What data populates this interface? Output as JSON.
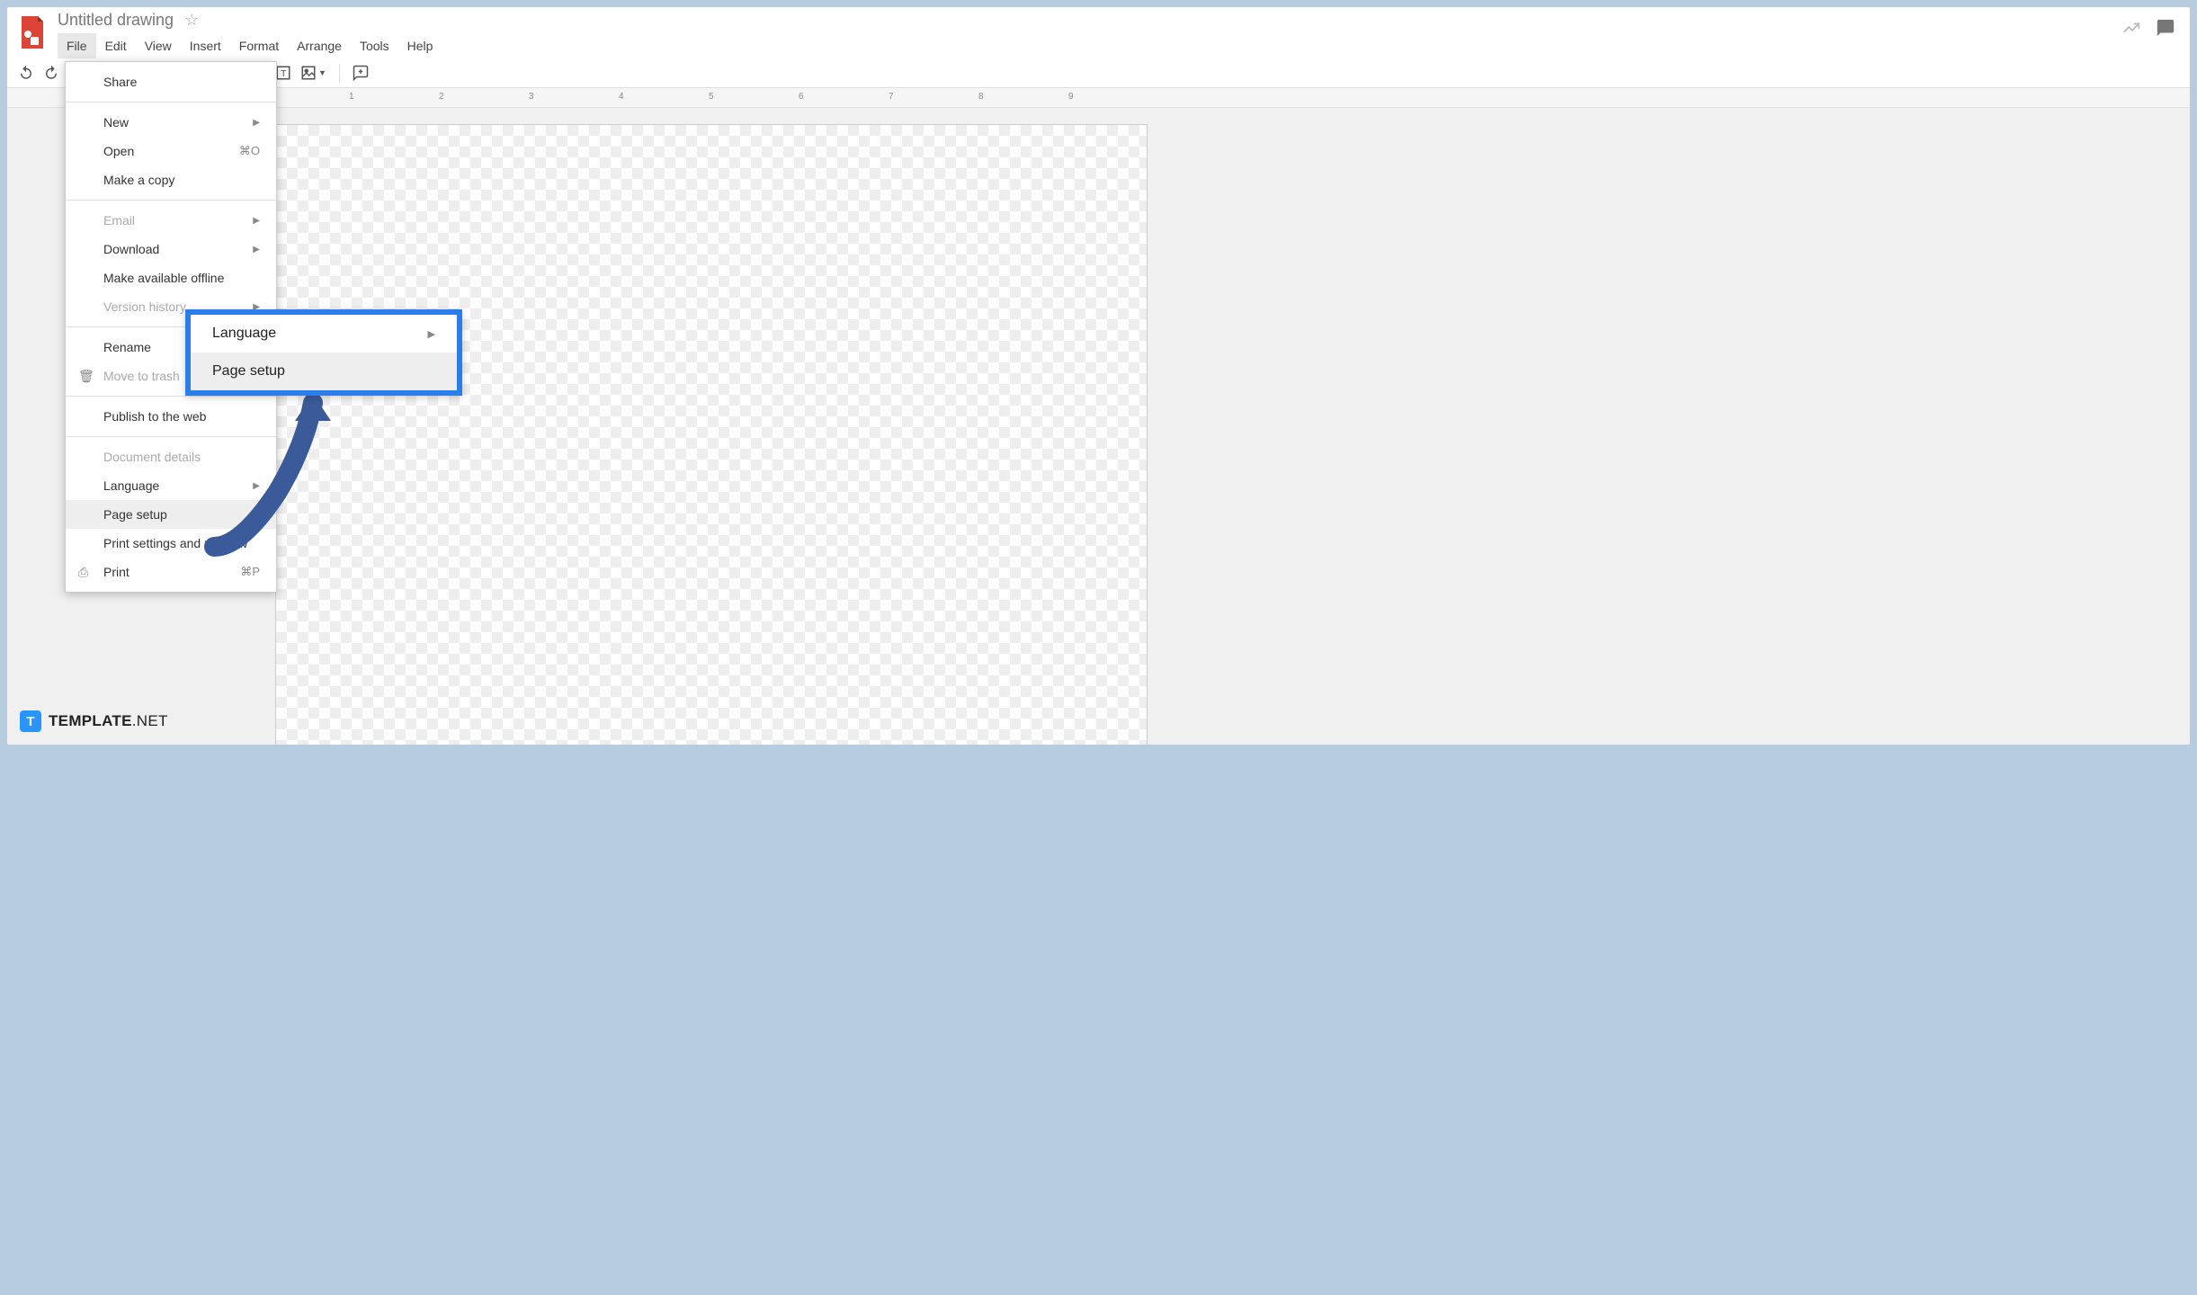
{
  "doc_title": "Untitled drawing",
  "menubar": {
    "file": "File",
    "edit": "Edit",
    "view": "View",
    "insert": "Insert",
    "format": "Format",
    "arrange": "Arrange",
    "tools": "Tools",
    "help": "Help"
  },
  "ruler_ticks": [
    "1",
    "2",
    "3",
    "4",
    "5",
    "6",
    "7",
    "8",
    "9"
  ],
  "file_menu": {
    "share": "Share",
    "new": "New",
    "open": "Open",
    "open_shortcut": "⌘O",
    "make_copy": "Make a copy",
    "email": "Email",
    "download": "Download",
    "make_offline": "Make available offline",
    "version_history": "Version history",
    "rename": "Rename",
    "move_trash": "Move to trash",
    "publish": "Publish to the web",
    "doc_details": "Document details",
    "language": "Language",
    "page_setup": "Page setup",
    "print_settings": "Print settings and preview",
    "print": "Print",
    "print_shortcut": "⌘P"
  },
  "callout": {
    "language": "Language",
    "page_setup": "Page setup"
  },
  "watermark": {
    "brand": "TEMPLATE",
    "suffix": ".NET"
  }
}
